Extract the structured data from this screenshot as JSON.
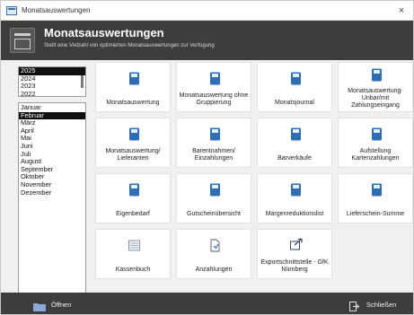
{
  "window": {
    "title": "Monatsauswertungen",
    "close_glyph": "×"
  },
  "header": {
    "title": "Monatsauswertungen",
    "subtitle": "Stellt eine Vielzahl von optimierten Monatsauswertungen zur Verfügung"
  },
  "years": {
    "items": [
      "2025",
      "2024",
      "2023",
      "2022"
    ],
    "selected": "2025"
  },
  "months": {
    "items": [
      "Januar",
      "Februar",
      "März",
      "April",
      "Mai",
      "Juni",
      "Juli",
      "August",
      "September",
      "Oktober",
      "November",
      "Dezember"
    ],
    "selected": "Februar"
  },
  "tiles": {
    "t1": "Monatsauswertung",
    "t2": "Monatsauswertung ohne Gruppierung",
    "t3": "Monatsjournal",
    "t4": "Monatsauswertung- Unbar/mit Zahlungseingang",
    "t5": "Monatsauswertung/ Lieferanten",
    "t6": "Barentnahmen/ Einzahlungen",
    "t7": "Barverkäufe",
    "t8": "Aufstellung Kartenzahlungen",
    "t9": "Eigenbedarf",
    "t10": "Gutscheinübersicht",
    "t11": "Margenreduktionslist",
    "t12": "Lieferschein-Summe",
    "t13": "Kassenbuch",
    "t14": "Anzahlungen",
    "t15": "Exportschnittstelle - GfK Nürnberg"
  },
  "icons": {
    "report": "report-icon",
    "cashbook": "cashbook-icon",
    "deposit": "deposit-icon",
    "export": "export-icon"
  },
  "footer": {
    "open_label": "Öffnen",
    "close_label": "Schließen"
  },
  "colors": {
    "accent": "#2f6db5",
    "header_bg": "#3d3d3d"
  }
}
